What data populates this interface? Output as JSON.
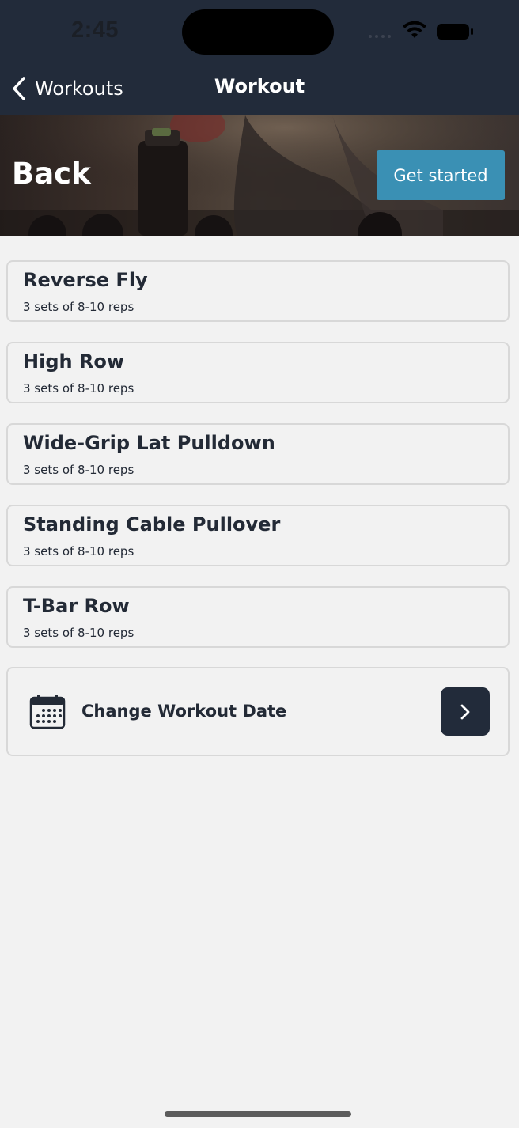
{
  "status_bar": {
    "time": "2:45"
  },
  "nav": {
    "back_label": "Workouts",
    "title": "Workout"
  },
  "hero": {
    "title": "Back",
    "button_label": "Get started"
  },
  "exercises": [
    {
      "name": "Reverse Fly",
      "detail": "3 sets of 8-10 reps"
    },
    {
      "name": "High Row",
      "detail": "3 sets of 8-10 reps"
    },
    {
      "name": "Wide-Grip Lat Pulldown",
      "detail": "3 sets of 8-10 reps"
    },
    {
      "name": "Standing Cable Pullover",
      "detail": "3 sets of 8-10 reps"
    },
    {
      "name": "T-Bar Row",
      "detail": "3 sets of 8-10 reps"
    }
  ],
  "date_action": {
    "label": "Change Workout Date",
    "icon": "calendar-icon",
    "arrow_icon": "chevron-right-icon"
  },
  "colors": {
    "nav_bg": "#222b3a",
    "accent": "#3a90b4",
    "page_bg": "#f2f2f2",
    "text": "#232a36"
  }
}
